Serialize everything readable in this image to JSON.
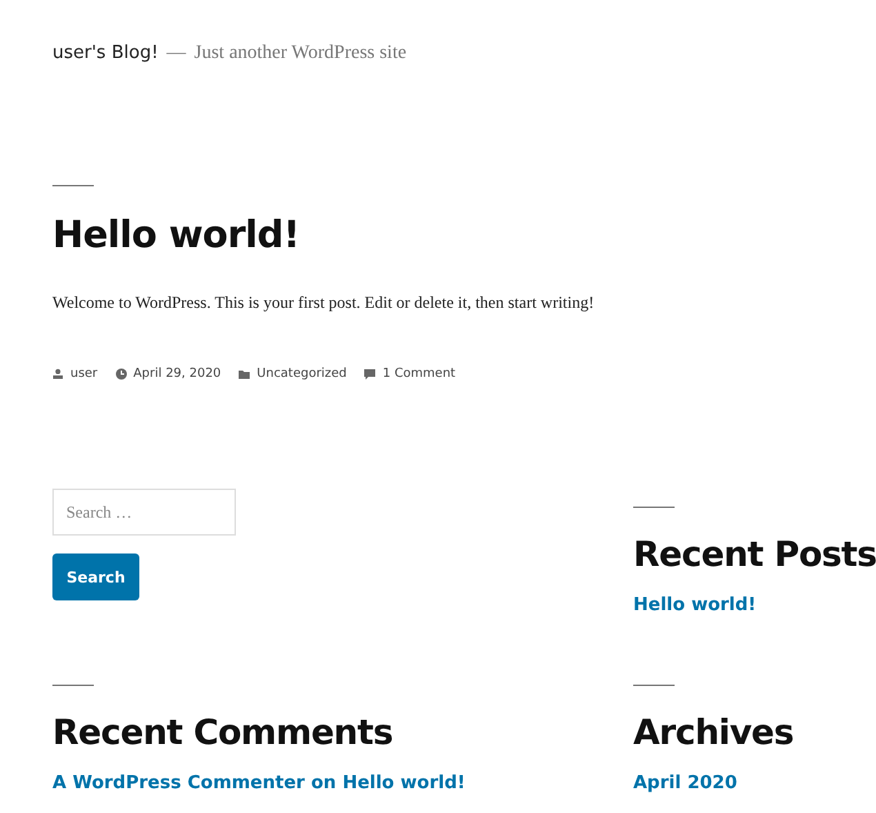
{
  "site": {
    "title": "user's Blog!",
    "separator": "—",
    "tagline": "Just another WordPress site"
  },
  "post": {
    "title": "Hello world!",
    "body": "Welcome to WordPress. This is your first post. Edit or delete it, then start writing!",
    "meta": [
      {
        "kind": "author",
        "text": "user"
      },
      {
        "kind": "date",
        "text": "April 29, 2020"
      },
      {
        "kind": "category",
        "text": "Uncategorized"
      },
      {
        "kind": "comments",
        "text": "1 Comment"
      }
    ]
  },
  "search": {
    "placeholder": "Search …",
    "button": "Search"
  },
  "recent_posts": {
    "title": "Recent Posts",
    "items": [
      "Hello world!"
    ]
  },
  "recent_comments": {
    "title": "Recent Comments",
    "items": [
      {
        "author": "A WordPress Commenter",
        "joiner": "on",
        "post": "Hello world!"
      }
    ]
  },
  "archives": {
    "title": "Archives",
    "items": [
      "April 2020"
    ]
  }
}
